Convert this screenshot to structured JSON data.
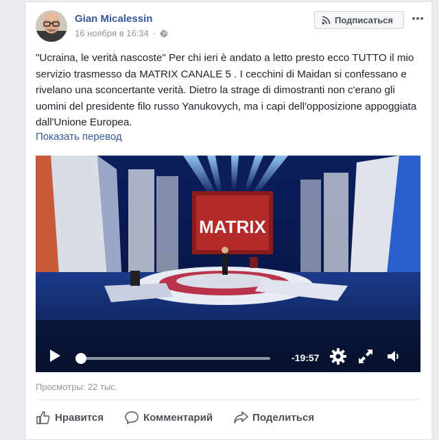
{
  "post": {
    "author": "Gian Micalessin",
    "timestamp": "16 ноября в 16:34",
    "separator": "·",
    "subscribe_label": "Подписаться",
    "text": "\"Ucraina, le verità nascoste\" Per chi ieri è andato a letto presto ecco TUTTO il mio servizio trasmesso da MATRIX CANALE 5 . I cecchini di Maidan si confessano e rivelano una sconcertante verità. Dietro la strage di dimostranti non c'erano gli uomini del presidente filo russo Yanukovych, ma i capi dell'opposizione appoggiata dall'Unione Europea.",
    "translate_link": "Показать перевод"
  },
  "video": {
    "screen_title": "MATRIX",
    "time_remaining": "-19:57",
    "progress": 0.0,
    "icons": {
      "play": "play-icon",
      "settings": "gear-icon",
      "fullscreen": "fullscreen-icon",
      "volume": "volume-icon"
    }
  },
  "stats": {
    "views": "Просмотры: 22 тыс."
  },
  "actions": {
    "like": "Нравится",
    "comment": "Комментарий",
    "share": "Поделиться"
  },
  "colors": {
    "link": "#365899",
    "page_bg": "#e9ebee",
    "muted": "#90949c"
  }
}
